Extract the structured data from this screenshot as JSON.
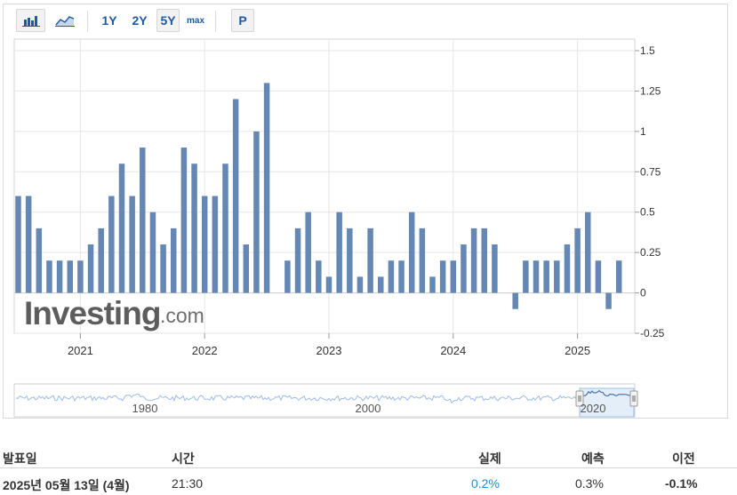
{
  "toolbar": {
    "bar_chart_icon": "bar-chart-icon",
    "area_chart_icon": "area-chart-icon",
    "range_1y": "1Y",
    "range_2y": "2Y",
    "range_5y": "5Y",
    "range_max": "max",
    "p_button": "P"
  },
  "watermark": {
    "brand": "Investing",
    "suffix": ".com"
  },
  "colors": {
    "bar": "#6587b4",
    "grid": "#e6e6e6",
    "axis_text": "#333333",
    "actual_value": "#1a8fd0",
    "navigator_line": "#9dbde6",
    "navigator_fill": "#dbe8f7"
  },
  "chart_data": {
    "type": "bar",
    "categories": [
      "2020-07",
      "2020-08",
      "2020-09",
      "2020-10",
      "2020-11",
      "2020-12",
      "2021-01",
      "2021-02",
      "2021-03",
      "2021-04",
      "2021-05",
      "2021-06",
      "2021-07",
      "2021-08",
      "2021-09",
      "2021-10",
      "2021-11",
      "2021-12",
      "2022-01",
      "2022-02",
      "2022-03",
      "2022-04",
      "2022-05",
      "2022-06",
      "2022-07",
      "2022-08",
      "2022-09",
      "2022-10",
      "2022-11",
      "2022-12",
      "2023-01",
      "2023-02",
      "2023-03",
      "2023-04",
      "2023-05",
      "2023-06",
      "2023-07",
      "2023-08",
      "2023-09",
      "2023-10",
      "2023-11",
      "2023-12",
      "2024-01",
      "2024-02",
      "2024-03",
      "2024-04",
      "2024-05",
      "2024-06",
      "2024-07",
      "2024-08",
      "2024-09",
      "2024-10",
      "2024-11",
      "2024-12",
      "2025-01",
      "2025-02",
      "2025-03",
      "2025-04"
    ],
    "values": [
      0.6,
      0.6,
      0.4,
      0.2,
      0.2,
      0.2,
      0.2,
      0.3,
      0.4,
      0.6,
      0.8,
      0.6,
      0.9,
      0.5,
      0.3,
      0.4,
      0.9,
      0.8,
      0.6,
      0.6,
      0.8,
      1.2,
      0.3,
      1.0,
      1.3,
      0.0,
      0.2,
      0.4,
      0.5,
      0.2,
      0.1,
      0.5,
      0.4,
      0.1,
      0.4,
      0.1,
      0.2,
      0.2,
      0.5,
      0.4,
      0.1,
      0.2,
      0.2,
      0.3,
      0.4,
      0.4,
      0.3,
      0.0,
      -0.1,
      0.2,
      0.2,
      0.2,
      0.2,
      0.3,
      0.4,
      0.5,
      0.2,
      -0.1,
      0.2
    ],
    "ylim": [
      -0.25,
      1.5
    ],
    "yticks": [
      -0.25,
      0,
      0.25,
      0.5,
      0.75,
      1,
      1.25,
      1.5
    ],
    "ytick_labels": [
      "-0.25",
      "0",
      "0.25",
      "0.5",
      "0.75",
      "1",
      "1.25",
      "1.5"
    ],
    "xtick_labels": [
      "2021",
      "2022",
      "2023",
      "2024",
      "2025"
    ],
    "xtick_months": [
      "2021-01",
      "2022-01",
      "2023-01",
      "2024-01",
      "2025-01"
    ],
    "grid": true,
    "title": "",
    "xlabel": "",
    "ylabel": ""
  },
  "navigator": {
    "labels": [
      "1980",
      "2000",
      "2020"
    ]
  },
  "table": {
    "headers": [
      "발표일",
      "시간",
      "실제",
      "예측",
      "이전"
    ],
    "rows": [
      {
        "date": "2025년 05월 13일 (4월)",
        "time": "21:30",
        "actual": "0.2%",
        "forecast": "0.3%",
        "previous": "-0.1%"
      }
    ]
  }
}
